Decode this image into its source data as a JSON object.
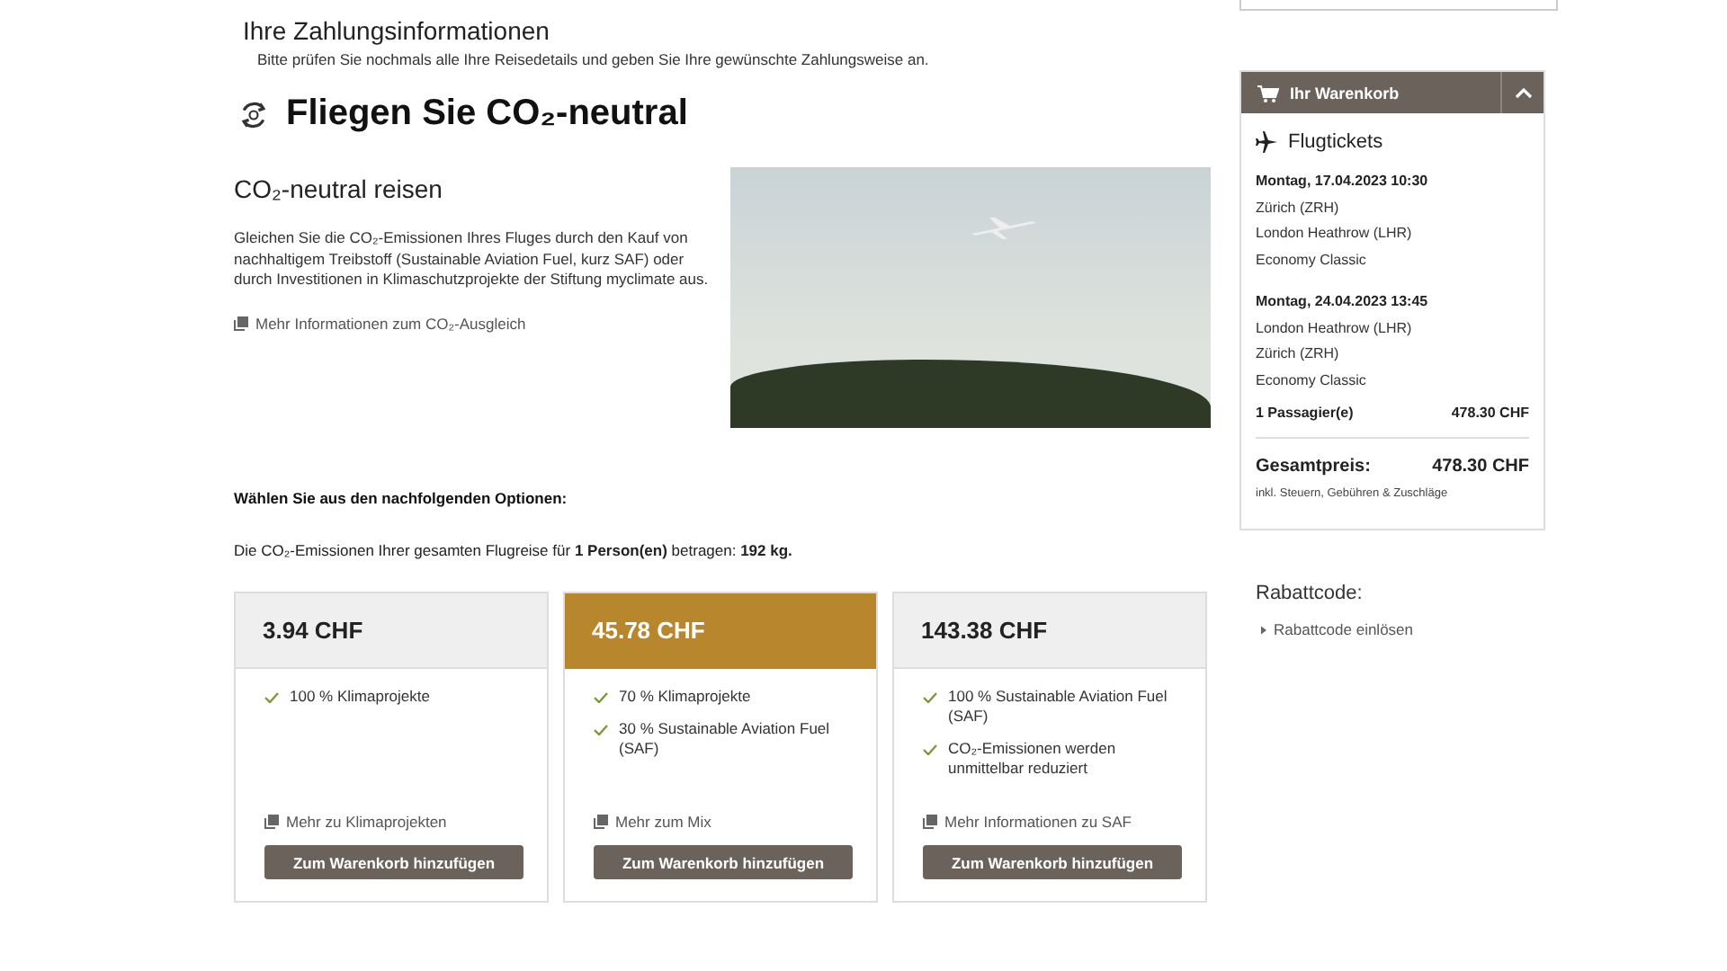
{
  "header": {
    "title": "Ihre Zahlungsinformationen",
    "subtitle": "Bitte prüfen Sie nochmals alle Ihre Reisedetails und geben Sie Ihre gewünschte Zahlungsweise an."
  },
  "co2": {
    "title": "Fliegen Sie CO₂-neutral",
    "subtitle": "CO₂-neutral reisen",
    "description": "Gleichen Sie die CO₂-Emissionen Ihres Fluges durch den Kauf von nachhaltigem Treibstoff (Sustainable Aviation Fuel, kurz SAF) oder durch Investitionen in Klimaschutzprojekte der Stiftung myclimate aus.",
    "info_link": "Mehr Informationen zum CO₂-Ausgleich",
    "options_heading": "Wählen Sie aus den nachfolgenden Optionen:",
    "emissions_text": "Die CO₂-Emissionen Ihrer gesamten Flugreise für **1 Person(en)** betragen: **192 kg.**"
  },
  "options": [
    {
      "price": "3.94 CHF",
      "selected": false,
      "features": [
        "100 % Klimaprojekte"
      ],
      "link": "Mehr zu Klimaprojekten",
      "button": "Zum Warenkorb hinzufügen"
    },
    {
      "price": "45.78 CHF",
      "selected": true,
      "features": [
        "70 % Klimaprojekte",
        "30 % Sustainable Aviation Fuel (SAF)"
      ],
      "link": "Mehr zum Mix",
      "button": "Zum Warenkorb hinzufügen"
    },
    {
      "price": "143.38 CHF",
      "selected": false,
      "features": [
        "100 % Sustainable Aviation Fuel (SAF)",
        "CO₂-Emissionen werden unmittelbar reduziert"
      ],
      "link": "Mehr Informationen zu SAF",
      "button": "Zum Warenkorb hinzufügen"
    }
  ],
  "cart": {
    "title": "Ihr Warenkorb",
    "expanded": true,
    "section": "Flugtickets",
    "flights": [
      {
        "date": "Montag, 17.04.2023 10:30",
        "lines": [
          "Zürich (ZRH)",
          "London Heathrow (LHR)",
          "Economy Classic"
        ]
      },
      {
        "date": "Montag, 24.04.2023 13:45",
        "lines": [
          "London Heathrow (LHR)",
          "Zürich (ZRH)",
          "Economy Classic"
        ]
      }
    ],
    "passengers": "1 Passagier(e)",
    "passengers_price": "478.30 CHF",
    "total_label": "Gesamtpreis:",
    "total_price": "478.30 CHF",
    "total_note": "inkl. Steuern, Gebühren & Zuschläge"
  },
  "discount": {
    "title": "Rabattcode:",
    "link": "Rabattcode einlösen"
  }
}
